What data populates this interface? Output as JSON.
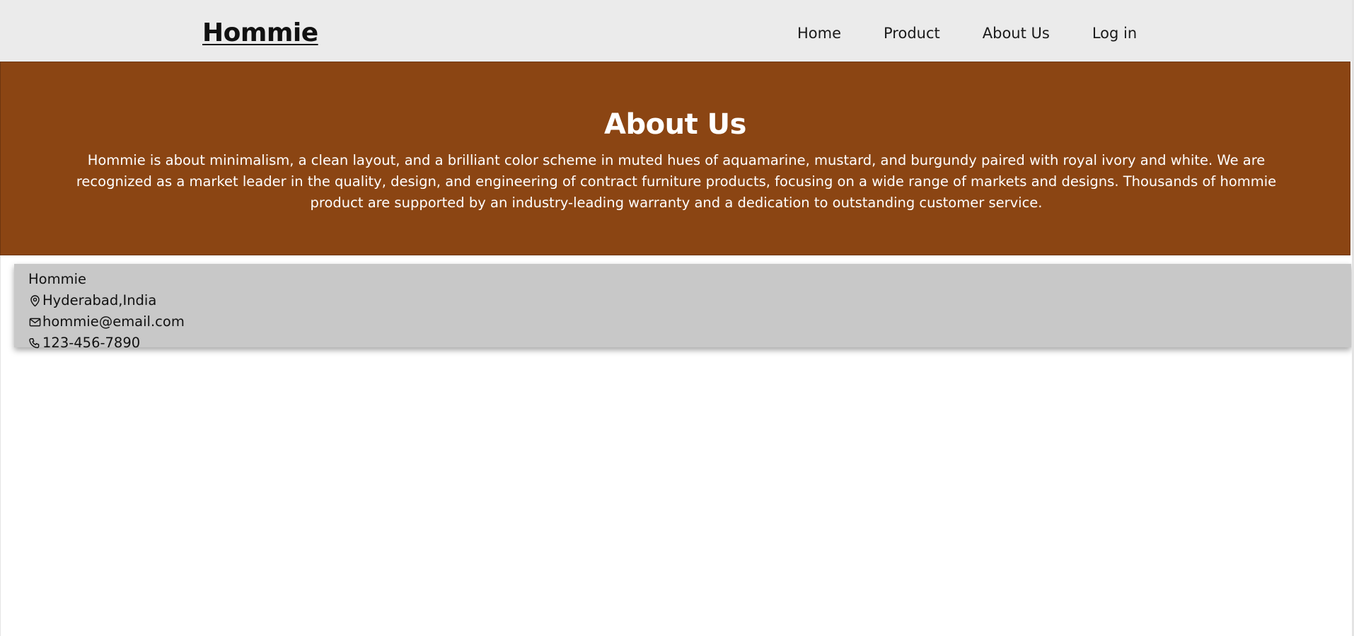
{
  "header": {
    "brand": "Hommie",
    "nav": [
      {
        "label": "Home"
      },
      {
        "label": "Product"
      },
      {
        "label": "About Us"
      },
      {
        "label": "Log in"
      }
    ]
  },
  "hero": {
    "title": "About Us",
    "text": "Hommie is about minimalism, a clean layout, and a brilliant color scheme in muted hues of aquamarine, mustard, and burgundy paired with royal ivory and white. We are recognized as a market leader in the quality, design, and engineering of contract furniture products, focusing on a wide range of markets and designs. Thousands of hommie product are supported by an industry-leading warranty and a dedication to outstanding customer service."
  },
  "contact": {
    "name": "Hommie",
    "location": "Hyderabad,India",
    "email": "hommie@email.com",
    "phone": "123-456-7890"
  },
  "icons": {
    "location": "map-pin-icon",
    "email": "envelope-icon",
    "phone": "phone-icon"
  },
  "colors": {
    "navbar_bg": "#ebebeb",
    "hero_bg": "#8b4513",
    "footer_bg": "#c8c8c8",
    "text_light": "#ffffff",
    "text_dark": "#111111"
  }
}
